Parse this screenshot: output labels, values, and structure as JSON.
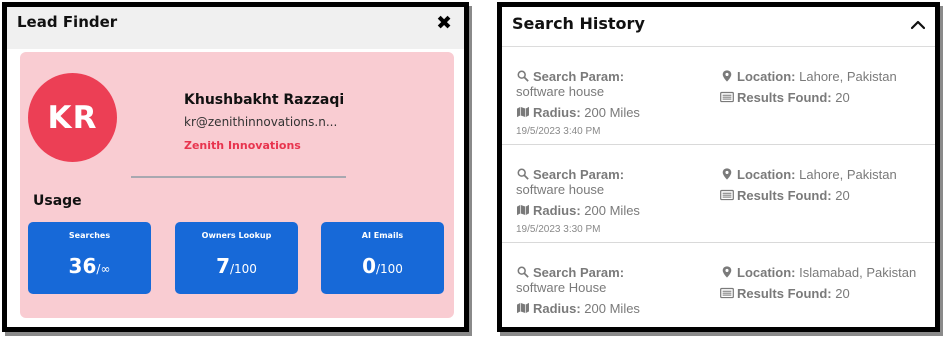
{
  "lead_finder": {
    "title": "Lead Finder",
    "close_glyph": "✖",
    "profile": {
      "initials": "KR",
      "name": "Khushbakht Razzaqi",
      "email": "kr@zenithinnovations.n...",
      "company": "Zenith Innovations"
    },
    "usage": {
      "title": "Usage",
      "stats": [
        {
          "label": "Searches",
          "value": "36",
          "separator": "/",
          "max": "∞"
        },
        {
          "label": "Owners Lookup",
          "value": "7",
          "separator": "/",
          "max": "100"
        },
        {
          "label": "AI Emails",
          "value": "0",
          "separator": "/",
          "max": "100"
        }
      ]
    }
  },
  "search_history": {
    "title": "Search History",
    "entries": [
      {
        "param_label": "Search Param:",
        "param_value": "software house",
        "location_label": "Location:",
        "location_value": "Lahore, Pakistan",
        "radius_label": "Radius:",
        "radius_value": "200 Miles",
        "results_label": "Results Found:",
        "results_value": "20",
        "timestamp": "19/5/2023 3:40 PM"
      },
      {
        "param_label": "Search Param:",
        "param_value": "software house",
        "location_label": "Location:",
        "location_value": "Lahore, Pakistan",
        "radius_label": "Radius:",
        "radius_value": "200 Miles",
        "results_label": "Results Found:",
        "results_value": "20",
        "timestamp": "19/5/2023 3:30 PM"
      },
      {
        "param_label": "Search Param:",
        "param_value": "software House",
        "location_label": "Location:",
        "location_value": "Islamabad, Pakistan",
        "radius_label": "Radius:",
        "radius_value": "200 Miles",
        "results_label": "Results Found:",
        "results_value": "20",
        "timestamp": ""
      }
    ]
  },
  "colors": {
    "avatar": "#ec3f55",
    "card_bg": "#f9ccd2",
    "stat_bg": "#1769d8",
    "company_text": "#e8344e"
  },
  "icons": {
    "search": "search-icon",
    "location": "location-pin-icon",
    "radius": "map-icon",
    "results": "list-icon",
    "close": "close-icon",
    "collapse": "chevron-up-icon"
  }
}
